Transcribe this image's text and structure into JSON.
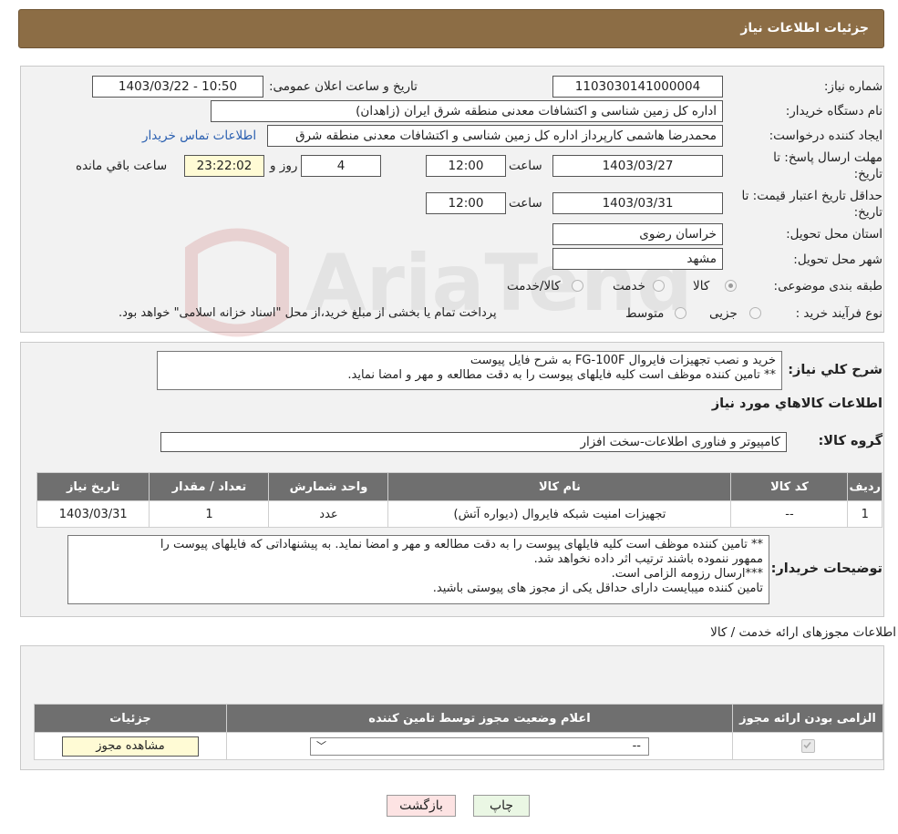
{
  "header": {
    "title": "جزئیات اطلاعات نیاز"
  },
  "form": {
    "need_number_label": "شماره نیاز:",
    "need_number": "1103030141000004",
    "announce_label": "تاریخ و ساعت اعلان عمومی:",
    "announce_value": "1403/03/22 - 10:50",
    "buyer_org_label": "نام دستگاه خریدار:",
    "buyer_org": "اداره کل زمین شناسی و اکتشافات معدنی منطقه شرق ایران (زاهدان)",
    "requester_label": "ایجاد کننده درخواست:",
    "requester": "محمدرضا هاشمی کارپرداز اداره کل زمین شناسی و اکتشافات معدنی منطقه شرق",
    "contact_link": "اطلاعات تماس خریدار",
    "deadline_label_1": "مهلت ارسال پاسخ: تا",
    "deadline_label_2": "تاریخ:",
    "deadline_date": "1403/03/27",
    "time_label": "ساعت",
    "deadline_time": "12:00",
    "days_value": "4",
    "days_label": "روز و",
    "remaining_time": "23:22:02",
    "remaining_label": "ساعت باقي مانده",
    "validity_label_1": "حداقل تاریخ اعتبار قیمت: تا",
    "validity_label_2": "تاریخ:",
    "validity_date": "1403/03/31",
    "validity_time": "12:00",
    "province_label": "استان محل تحویل:",
    "province": "خراسان رضوی",
    "city_label": "شهر محل تحویل:",
    "city": "مشهد",
    "category_label": "طبقه بندی موضوعی:",
    "category_options": [
      "کالا",
      "خدمت",
      "کالا/خدمت"
    ],
    "category_selected": "کالا",
    "process_label": "نوع فرآیند خرید :",
    "process_options": [
      "جزیی",
      "متوسط"
    ],
    "process_note": "پرداخت تمام یا بخشی از مبلغ خرید،از محل \"اسناد خزانه اسلامی\" خواهد بود."
  },
  "summary": {
    "label": "شرح کلي نياز:",
    "line1": "خرید و نصب تجهیزات فایروال  FG-100F به شرح فایل پیوست",
    "line2": "** تامین کننده موظف است کلیه فایلهای پیوست را به دقت مطالعه و مهر و امضا نماید."
  },
  "goods": {
    "section_title": "اطلاعات کالاهاي مورد نياز",
    "group_label": "گروه کالا:",
    "group_value": "کامپیوتر و فناوری اطلاعات-سخت افزار",
    "columns": [
      "رديف",
      "کد کالا",
      "نام کالا",
      "واحد شمارش",
      "تعداد / مقدار",
      "تاریخ نیاز"
    ],
    "rows": [
      [
        "1",
        "--",
        "تجهیزات امنیت شبکه فایروال (دیواره آتش)",
        "عدد",
        "1",
        "1403/03/31"
      ]
    ]
  },
  "buyer_notes": {
    "label": "توضیحات خریدار:",
    "line1": "** تامین کننده موظف است کلیه فایلهای پیوست را به دقت مطالعه و مهر و امضا نماید. به پیشنهاداتی که فایلهای پیوست را",
    "line2": "ممهور ننموده باشند ترتیب اثر داده نخواهد شد.",
    "line3": "***ارسال رزومه الزامی است.",
    "line4": "تامین کننده میبایست دارای حداقل یکی از مجوز های پیوستی باشید."
  },
  "permits": {
    "section_title": "اطلاعات مجوزهای ارائه خدمت / کالا",
    "columns": [
      "الزامی بودن ارائه مجوز",
      "اعلام وضعیت مجوز توسط تامین کننده",
      "جزئیات"
    ],
    "select_value": "--",
    "view_button": "مشاهده مجوز"
  },
  "footer": {
    "print_button": "چاپ",
    "back_button": "بازگشت"
  },
  "watermark": {
    "text": "AriaTender.neT"
  },
  "colors": {
    "header": "#8c6d45",
    "table_header": "#6f6f6f",
    "link": "#2a5fb0",
    "back_button": "#fde3e3",
    "print_button": "#eaf7e4"
  }
}
